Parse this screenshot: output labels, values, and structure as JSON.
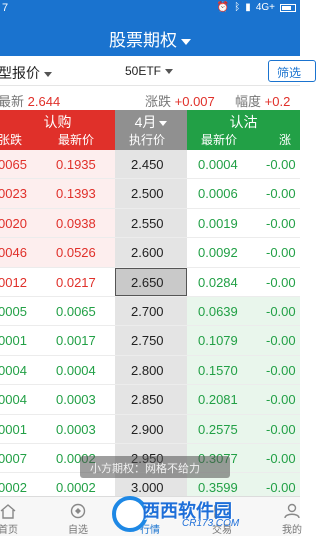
{
  "status_bar": {
    "time": "7",
    "network": "4G+"
  },
  "app_bar": {
    "title": "股票期权"
  },
  "selector": {
    "left_label": "型报价",
    "underlying": "50ETF",
    "filter_button": "筛选"
  },
  "quote": {
    "last_label": "最新",
    "last_value": "2.644",
    "change_label": "涨跌",
    "change_value": "+0.007",
    "range_label": "幅度",
    "range_value": "+0.2"
  },
  "header": {
    "call_title": "认购",
    "call_change": "张跌",
    "call_price": "最新价",
    "month": "4月",
    "strike_label": "执行价",
    "put_title": "认沽",
    "put_price": "最新价",
    "put_change": "涨跌"
  },
  "rows": [
    {
      "call_change": "0065",
      "call_price": "0.1935",
      "strike": "2.450",
      "put_price": "0.0004",
      "put_change": "-0.00",
      "side": "call"
    },
    {
      "call_change": "0023",
      "call_price": "0.1393",
      "strike": "2.500",
      "put_price": "0.0006",
      "put_change": "-0.00",
      "side": "call"
    },
    {
      "call_change": "0020",
      "call_price": "0.0938",
      "strike": "2.550",
      "put_price": "0.0019",
      "put_change": "-0.00",
      "side": "call"
    },
    {
      "call_change": "0046",
      "call_price": "0.0526",
      "strike": "2.600",
      "put_price": "0.0092",
      "put_change": "-0.00",
      "side": "call"
    },
    {
      "call_change": "0012",
      "call_price": "0.0217",
      "strike": "2.650",
      "put_price": "0.0284",
      "put_change": "-0.00",
      "side": "current"
    },
    {
      "call_change": "0005",
      "call_price": "0.0065",
      "strike": "2.700",
      "put_price": "0.0639",
      "put_change": "-0.00",
      "side": "put"
    },
    {
      "call_change": "0001",
      "call_price": "0.0017",
      "strike": "2.750",
      "put_price": "0.1079",
      "put_change": "-0.00",
      "side": "put"
    },
    {
      "call_change": "0004",
      "call_price": "0.0004",
      "strike": "2.800",
      "put_price": "0.1570",
      "put_change": "-0.00",
      "side": "put"
    },
    {
      "call_change": "0004",
      "call_price": "0.0003",
      "strike": "2.850",
      "put_price": "0.2081",
      "put_change": "-0.00",
      "side": "put"
    },
    {
      "call_change": "0001",
      "call_price": "0.0003",
      "strike": "2.900",
      "put_price": "0.2575",
      "put_change": "-0.00",
      "side": "put"
    },
    {
      "call_change": "0007",
      "call_price": "0.0002",
      "strike": "2.950",
      "put_price": "0.3077",
      "put_change": "-0.00",
      "side": "put"
    },
    {
      "call_change": "0002",
      "call_price": "0.0002",
      "strike": "3.000",
      "put_price": "0.3599",
      "put_change": "-0.00",
      "side": "put"
    }
  ],
  "toast": {
    "text": "小方期权：网格不给力"
  },
  "tabs": [
    {
      "label": "首页",
      "icon": "home-icon"
    },
    {
      "label": "自选",
      "icon": "favorites-icon"
    },
    {
      "label": "行情",
      "icon": "market-icon"
    },
    {
      "label": "交易",
      "icon": "trade-icon"
    },
    {
      "label": "我的",
      "icon": "profile-icon"
    }
  ],
  "watermark": {
    "text": "西西软件园",
    "url": "CR173.COM"
  },
  "colors": {
    "brand": "#1a73cf",
    "call_red": "#e0302a",
    "put_green": "#22a046"
  }
}
